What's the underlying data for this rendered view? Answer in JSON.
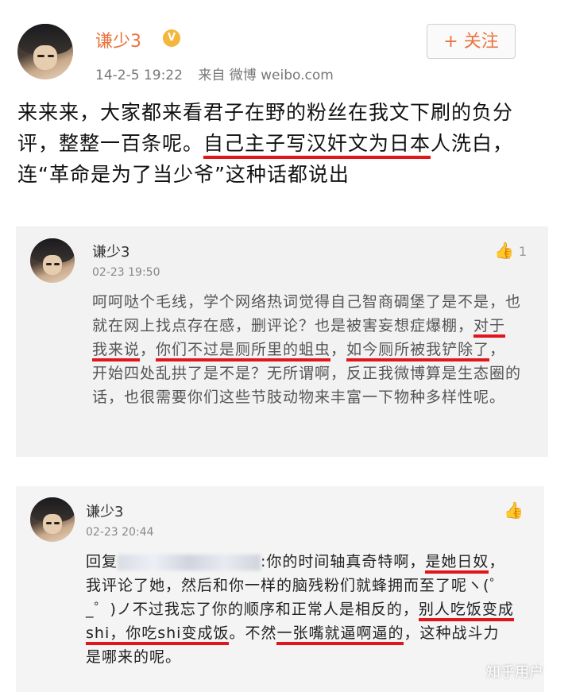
{
  "post": {
    "username": "谦少3",
    "vip_badge": "V",
    "date": "14-2-5 19:22",
    "source": "来自 微博 weibo.com",
    "follow_label": "+ 关注",
    "text_before": "来来来，大家都来看君子在野的粉丝在我文下刷的负分评，整整一百条呢。",
    "text_highlight": "自己主子写汉奸文为日本",
    "text_after": "人洗白，连“革命是为了当少爷”这种话都说出"
  },
  "comments": [
    {
      "username": "谦少3",
      "time": "02-23 19:50",
      "like_icon": "thumbs-up-icon",
      "likes": "1",
      "segments": [
        {
          "text": "呵呵哒个毛线，学个网络热词觉得自己智商碉堡了是不是，也就在网上找点存在感，删评论？也是被害妄想症爆棚，",
          "u": false
        },
        {
          "text": "对于我来说",
          "u": true
        },
        {
          "text": "，",
          "u": false
        },
        {
          "text": "你们不过是厕所里的蛆虫",
          "u": true
        },
        {
          "text": "，",
          "u": false
        },
        {
          "text": "如今厕所被我铲除了",
          "u": true
        },
        {
          "text": "，开始四处乱拱了是不是？无所谓啊，反正我微博算是生态圈的话，也很需要你们这些节肢动物来丰富一下物种多样性呢。",
          "u": false
        }
      ]
    },
    {
      "username": "谦少3",
      "time": "02-23 20:44",
      "like_icon": "thumbs-up-icon",
      "likes": "",
      "reply_prefix": "回复",
      "segments": [
        {
          "text": ":你的时间轴真奇特啊，",
          "u": false
        },
        {
          "text": "是她日奴",
          "u": true
        },
        {
          "text": "，我评论了她，然后和你一样的脑残粉们就蜂拥而至了呢ヽ(゜_゜)ノ不过我忘了你的顺序和正常人是相反的，",
          "u": false
        },
        {
          "text": "别人吃饭变成shi，你吃shi变成饭",
          "u": true
        },
        {
          "text": "。不然",
          "u": false
        },
        {
          "text": "一张嘴就逼啊逼的",
          "u": true
        },
        {
          "text": "，这种战斗力是哪来的呢。",
          "u": false
        }
      ]
    }
  ],
  "watermark": "知乎用户",
  "colors": {
    "accent": "#eb7340",
    "underline": "#e0161c"
  }
}
